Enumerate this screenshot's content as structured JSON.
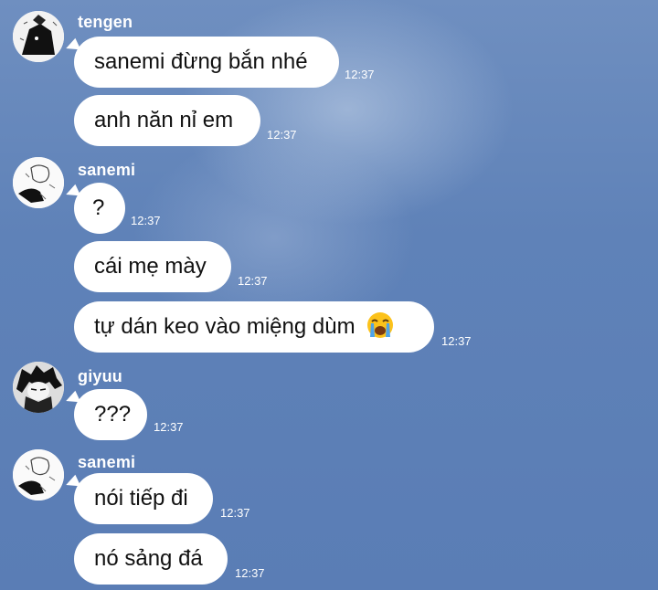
{
  "messages": [
    {
      "sender": "tengen",
      "text": "sanemi đừng bắn nhé",
      "time": "12:37"
    },
    {
      "sender": "",
      "text": "anh năn nỉ em",
      "time": "12:37"
    },
    {
      "sender": "sanemi",
      "text": "?",
      "time": "12:37"
    },
    {
      "sender": "",
      "text": "cái mẹ mày",
      "time": "12:37"
    },
    {
      "sender": "",
      "text": "tự dán keo vào miệng dùm",
      "emoji": "loudly-crying-face-icon",
      "time": "12:37"
    },
    {
      "sender": "giyuu",
      "text": "???",
      "time": "12:37"
    },
    {
      "sender": "sanemi",
      "text": "nói tiếp đi",
      "time": "12:37"
    },
    {
      "sender": "",
      "text": "nó sảng đá",
      "time": "12:37"
    }
  ]
}
